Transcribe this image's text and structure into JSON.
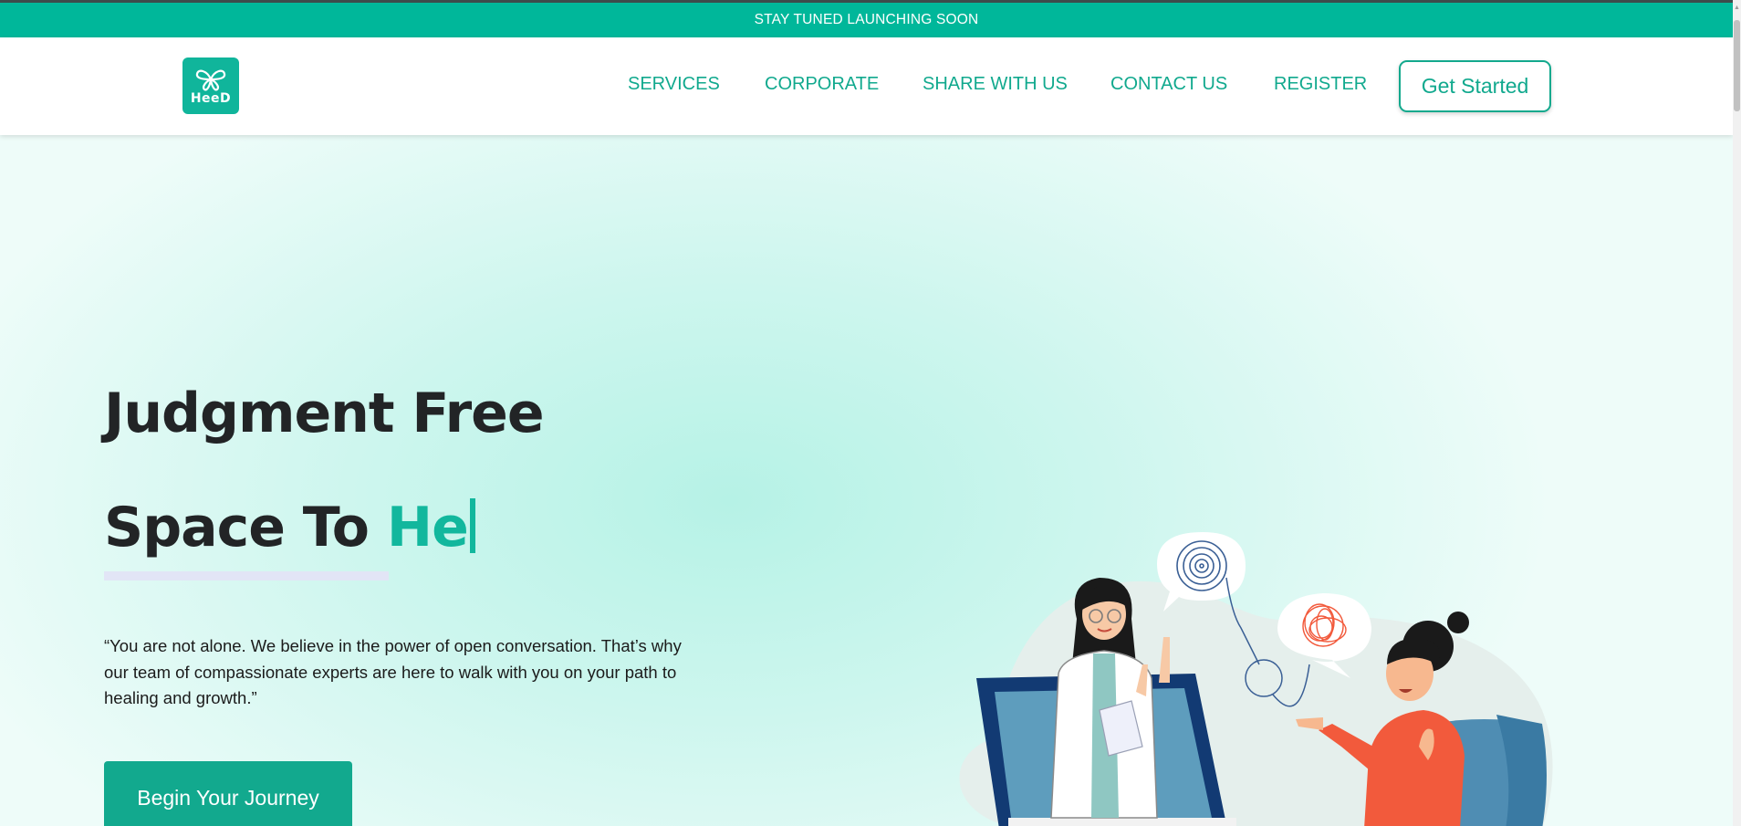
{
  "announcement": {
    "text": "STAY TUNED LAUNCHING SOON"
  },
  "brand": {
    "logo_text": "HeeD"
  },
  "nav": {
    "items": [
      {
        "label": "SERVICES"
      },
      {
        "label": "CORPORATE"
      },
      {
        "label": "SHARE WITH US"
      },
      {
        "label": "CONTACT US"
      },
      {
        "label": "REGISTER"
      }
    ],
    "cta_label": "Get Started"
  },
  "hero": {
    "line1": "Judgment Free",
    "line2_prefix": "Space To",
    "typed_text": "He",
    "quote": "“You are not alone. We believe in the power of open conversation. That’s why our team of compassionate experts are here to walk with you on your path to healing and growth.”",
    "button_label": "Begin Your Journey"
  },
  "colors": {
    "brand": "#00b79a",
    "brand_text": "#11a98e",
    "heading": "#222426",
    "accent_orange": "#f25a3c",
    "screen_navy": "#123a73"
  },
  "icons": [
    "butterfly-logo-icon",
    "spiral-thought-icon",
    "tangled-thought-icon"
  ]
}
